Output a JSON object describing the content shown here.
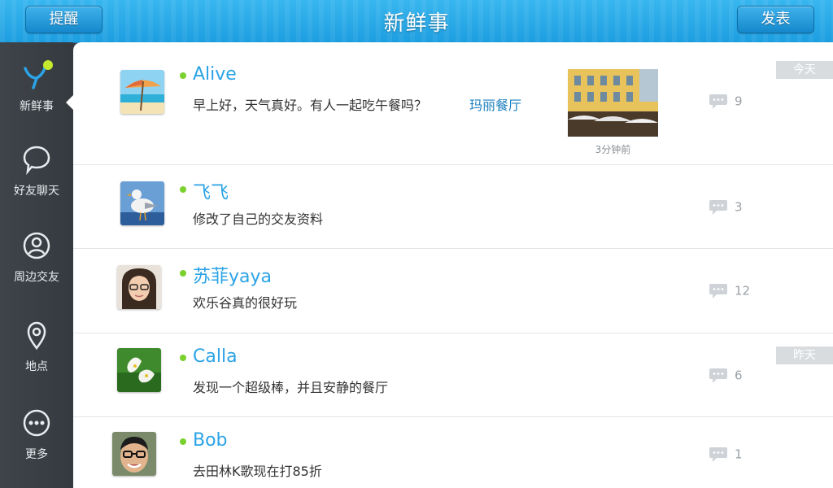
{
  "header": {
    "title": "新鲜事",
    "left_button": "提醒",
    "right_button": "发表"
  },
  "sidebar": {
    "items": [
      {
        "label": "新鲜事",
        "icon": "feed-icon"
      },
      {
        "label": "好友聊天",
        "icon": "chat-bubble-icon"
      },
      {
        "label": "周边交友",
        "icon": "person-icon"
      },
      {
        "label": "地点",
        "icon": "location-pin-icon"
      },
      {
        "label": "更多",
        "icon": "more-icon"
      }
    ]
  },
  "feed": [
    {
      "name": "Alive",
      "message": "早上好，天气真好。有人一起吃午餐吗？",
      "place": "玛丽餐厅",
      "time": "3分钟前",
      "comments": "9",
      "day_tag": "今天"
    },
    {
      "name": "飞飞",
      "message": "修改了自己的交友资料",
      "comments": "3"
    },
    {
      "name": "苏菲yaya",
      "message": "欢乐谷真的很好玩",
      "comments": "12"
    },
    {
      "name": "Calla",
      "message": "发现一个超级棒，并且安静的餐厅",
      "comments": "6",
      "day_tag": "昨天"
    },
    {
      "name": "Bob",
      "message": "去田林K歌现在打85折",
      "comments": "1"
    }
  ],
  "colors": {
    "accent": "#2ba3e6",
    "online": "#7ad12e",
    "sidebar": "#3b3f44"
  }
}
